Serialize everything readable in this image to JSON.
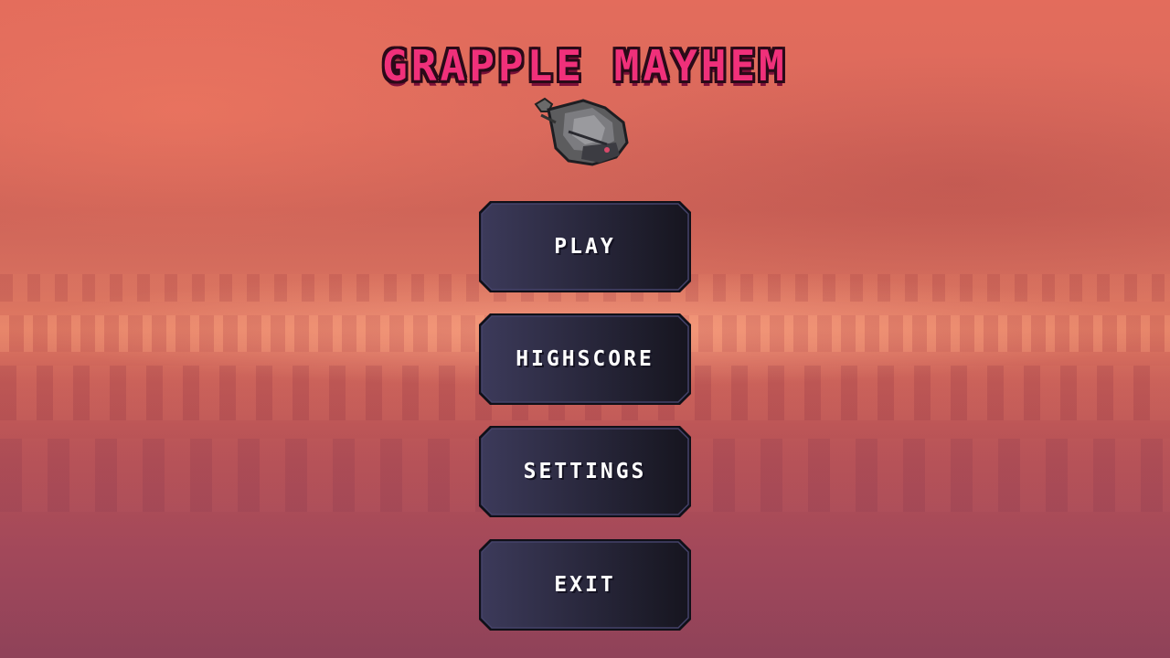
{
  "game": {
    "title": "GRAPPLE MAYHEM"
  },
  "menu": {
    "play_label": "PLAY",
    "highscore_label": "HIGHSCORE",
    "settings_label": "SETTINGS",
    "exit_label": "EXIT"
  },
  "icons": {
    "ship": "spaceship-icon"
  },
  "colors": {
    "title": "#f0307a",
    "title_outline": "#2a0a18",
    "button_fill_start": "#3c3a5a",
    "button_fill_end": "#16151f",
    "button_border": "#101018",
    "button_text": "#ffffff"
  }
}
